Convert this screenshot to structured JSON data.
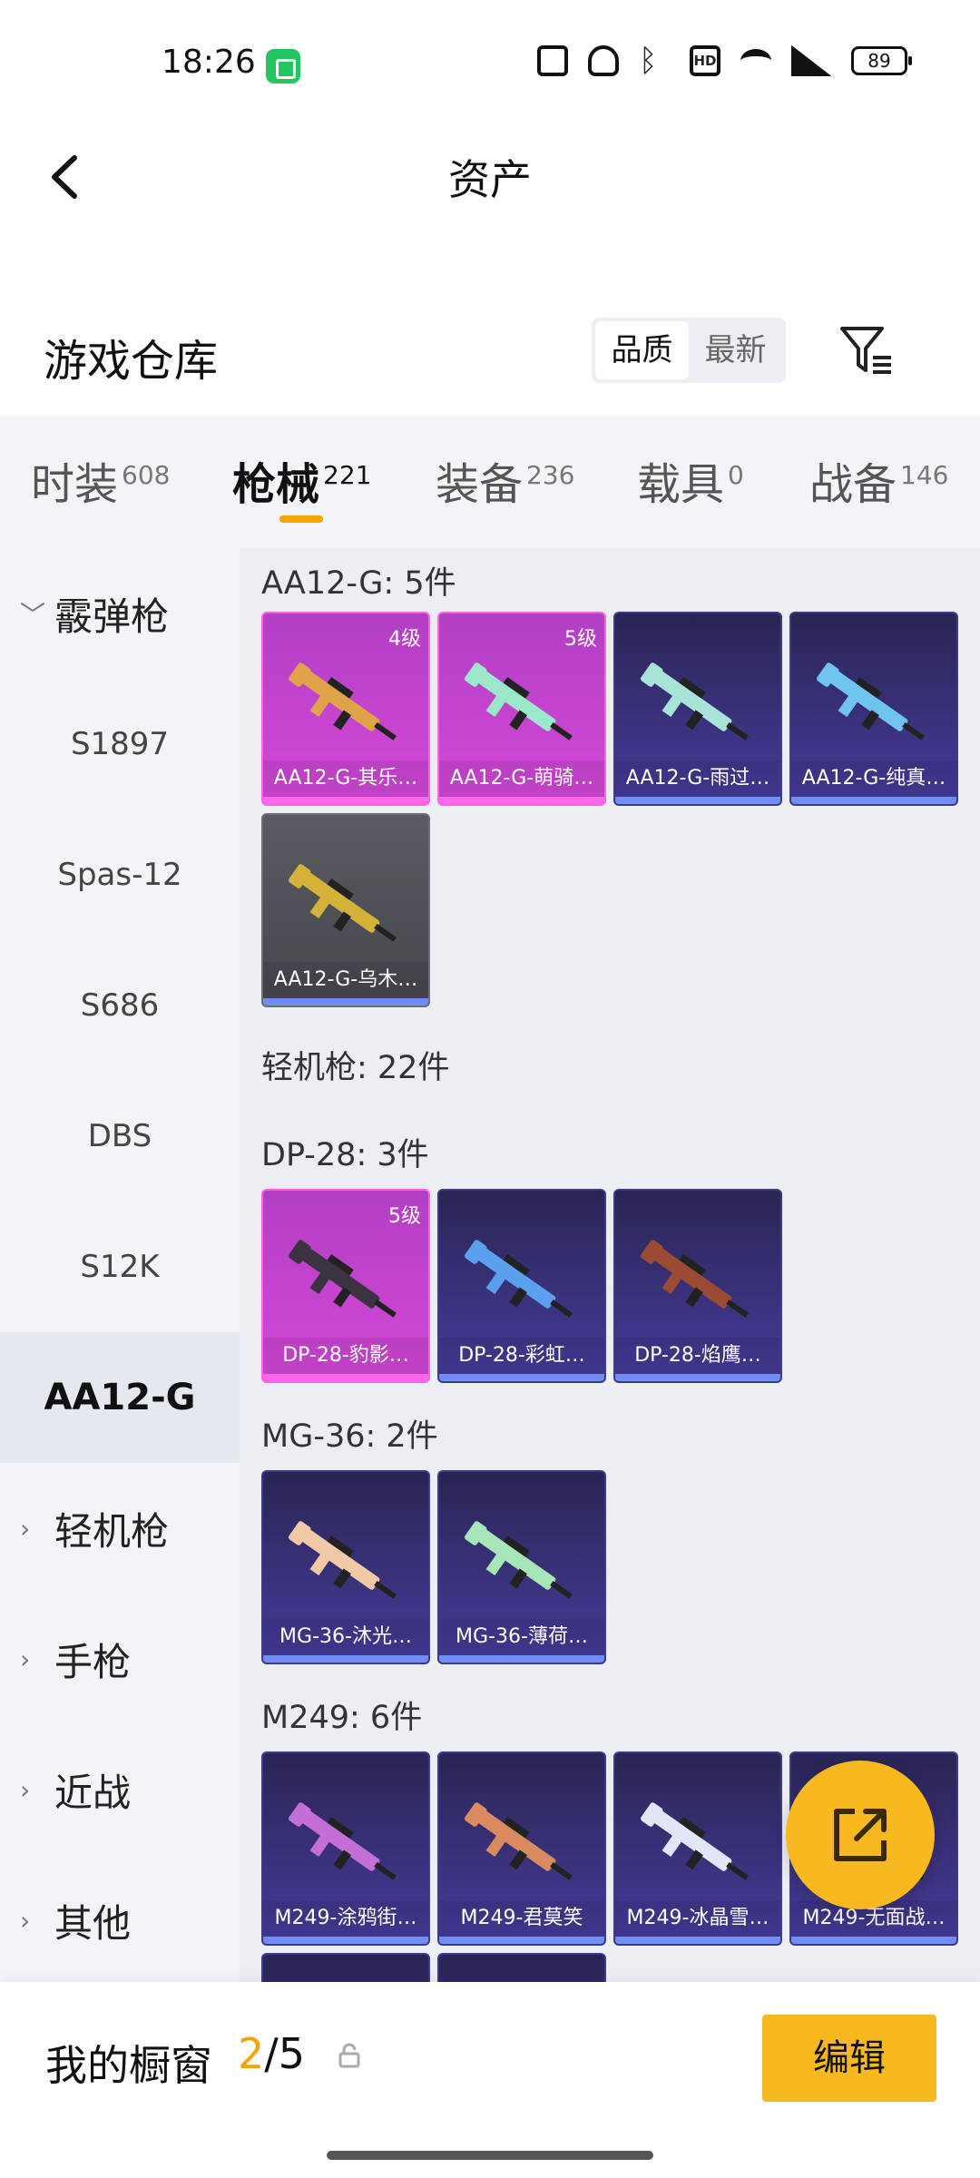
{
  "status_bar": {
    "time": "18:26",
    "battery": "89",
    "icons": [
      "nfc-icon",
      "mute-icon",
      "bluetooth-icon",
      "hd-icon",
      "wifi-icon",
      "signal-5g-icon",
      "battery-icon"
    ]
  },
  "header": {
    "title": "资产"
  },
  "warehouse": {
    "title": "游戏仓库",
    "sort_options": [
      "品质",
      "最新"
    ],
    "sort_selected": "品质"
  },
  "tabs": [
    {
      "label": "时装",
      "count": "608"
    },
    {
      "label": "枪械",
      "count": "221"
    },
    {
      "label": "装备",
      "count": "236"
    },
    {
      "label": "载具",
      "count": "0"
    },
    {
      "label": "战备",
      "count": "146"
    }
  ],
  "active_tab": "枪械",
  "sidebar": {
    "items": [
      {
        "label": "霰弹枪",
        "type": "group-open"
      },
      {
        "label": "S1897",
        "type": "sub"
      },
      {
        "label": "Spas-12",
        "type": "sub"
      },
      {
        "label": "S686",
        "type": "sub"
      },
      {
        "label": "DBS",
        "type": "sub"
      },
      {
        "label": "S12K",
        "type": "sub"
      },
      {
        "label": "AA12-G",
        "type": "active"
      },
      {
        "label": "轻机枪",
        "type": "group"
      },
      {
        "label": "手枪",
        "type": "group"
      },
      {
        "label": "近战",
        "type": "group"
      },
      {
        "label": "其他",
        "type": "group"
      }
    ]
  },
  "content": {
    "sections": [
      {
        "title": "AA12-G: 5件",
        "cards": [
          {
            "name": "AA12-G-其乐…",
            "level": "4级",
            "style": "pink",
            "gun_color": "#e0a34a"
          },
          {
            "name": "AA12-G-萌骑…",
            "level": "5级",
            "style": "pink",
            "gun_color": "#9be7c9"
          },
          {
            "name": "AA12-G-雨过…",
            "level": "",
            "style": "purple",
            "gun_color": "#a7e3d6"
          },
          {
            "name": "AA12-G-纯真…",
            "level": "",
            "style": "purple",
            "gun_color": "#6fc4ef"
          },
          {
            "name": "AA12-G-乌木…",
            "level": "",
            "style": "gray",
            "gun_color": "#d4b23a"
          }
        ]
      },
      {
        "title": "轻机枪: 22件",
        "cards": []
      },
      {
        "title": "DP-28: 3件",
        "cards": [
          {
            "name": "DP-28-豹影…",
            "level": "5级",
            "style": "pink",
            "gun_color": "#3b3340"
          },
          {
            "name": "DP-28-彩虹…",
            "level": "",
            "style": "purple",
            "gun_color": "#5aa0ef"
          },
          {
            "name": "DP-28-焰鹰…",
            "level": "",
            "style": "purple",
            "gun_color": "#9b4a33"
          }
        ]
      },
      {
        "title": "MG-36: 2件",
        "cards": [
          {
            "name": "MG-36-沐光…",
            "level": "",
            "style": "purple",
            "gun_color": "#f2c9a7"
          },
          {
            "name": "MG-36-薄荷…",
            "level": "",
            "style": "purple",
            "gun_color": "#a8e6b8"
          }
        ]
      },
      {
        "title": "M249: 6件",
        "cards": [
          {
            "name": "M249-涂鸦街…",
            "level": "",
            "style": "purple",
            "gun_color": "#c46fd8"
          },
          {
            "name": "M249-君莫笑",
            "level": "",
            "style": "purple",
            "gun_color": "#d98a5e"
          },
          {
            "name": "M249-冰晶雪…",
            "level": "",
            "style": "purple",
            "gun_color": "#dfe6f5"
          },
          {
            "name": "M249-无面战…",
            "level": "",
            "style": "purple",
            "gun_color": "#8aa4ff"
          },
          {
            "name": "",
            "level": "",
            "style": "purple",
            "gun_color": "#6b6fb0"
          },
          {
            "name": "",
            "level": "",
            "style": "purple",
            "gun_color": "#6b6fb0"
          }
        ]
      }
    ]
  },
  "fab": {
    "icon": "share-icon"
  },
  "bottom_bar": {
    "title": "我的橱窗",
    "current": "2",
    "total": "/5",
    "edit_label": "编辑"
  },
  "colors": {
    "accent": "#f8b81f",
    "tab_underline": "#f6a500"
  }
}
